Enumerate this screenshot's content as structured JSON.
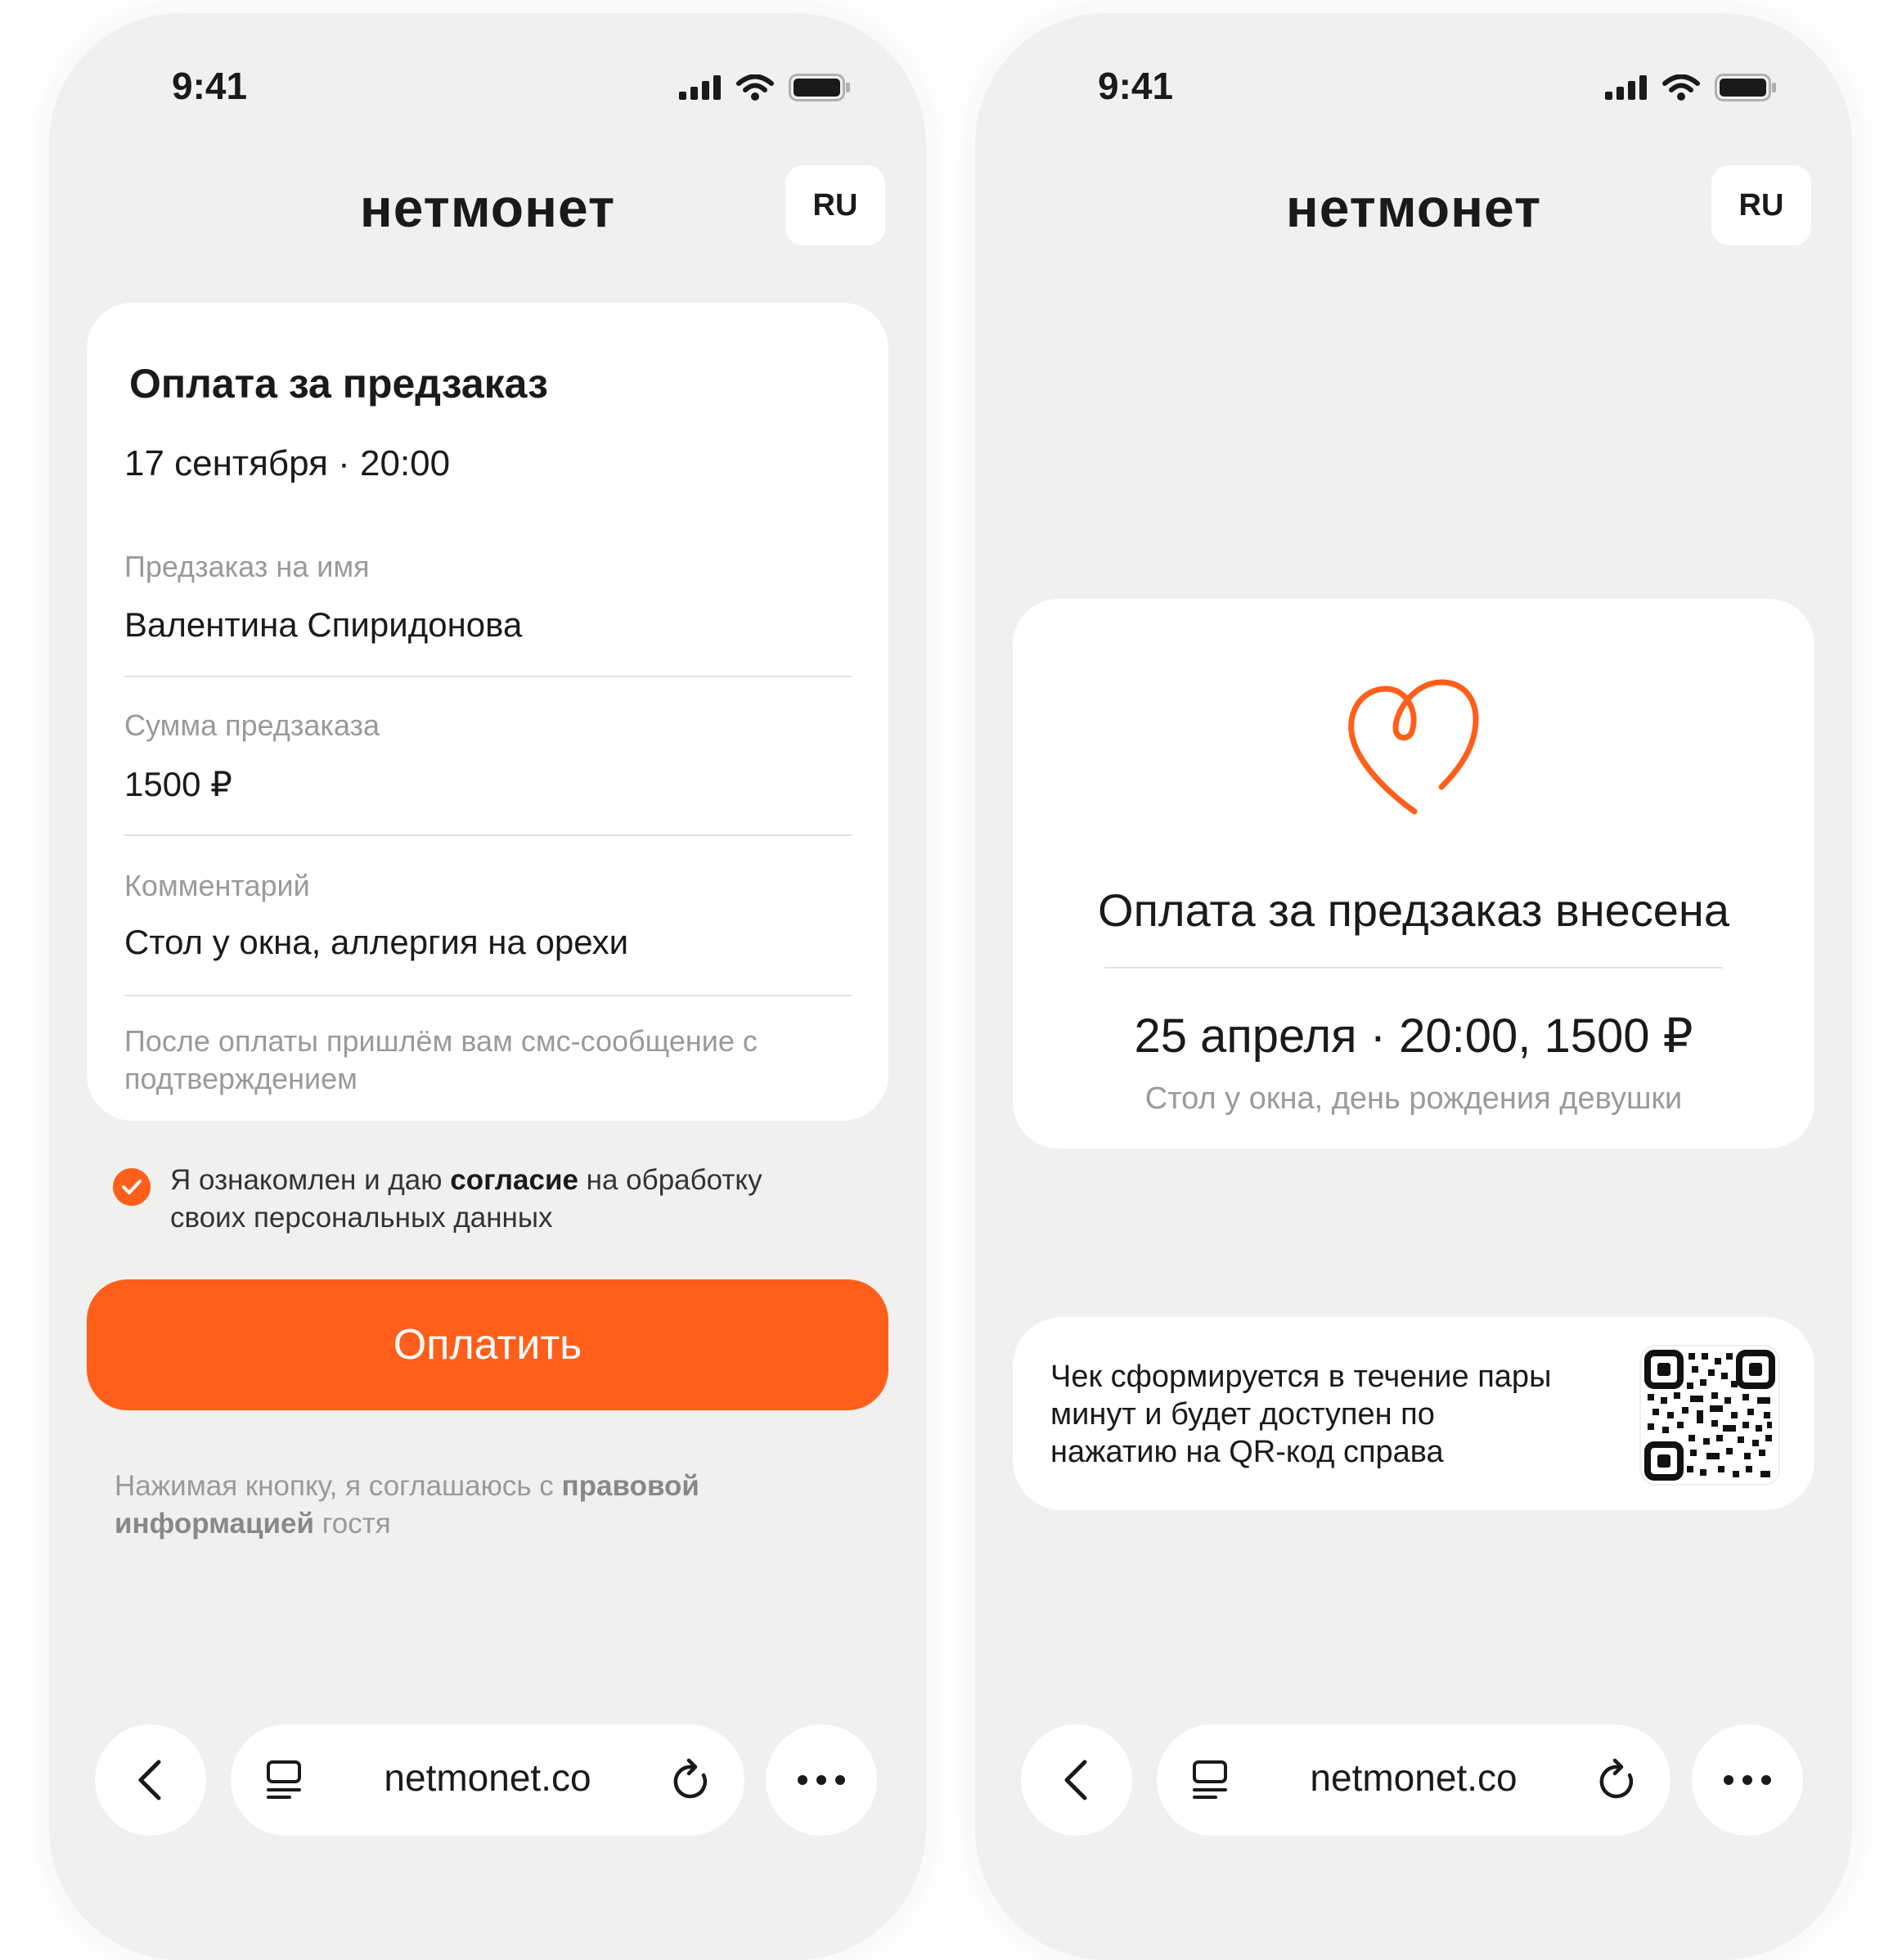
{
  "status_bar": {
    "time": "9:41"
  },
  "brand": {
    "logo": "нетмонет",
    "language": "RU",
    "accent_color": "#ff5f1a"
  },
  "payment_form": {
    "title": "Оплата за предзаказ",
    "datetime": "17 сентября · 20:00",
    "fields": [
      {
        "label": "Предзаказ на имя",
        "value": "Валентина Спиридонова"
      },
      {
        "label": "Сумма предзаказа",
        "value": "1500 ₽"
      },
      {
        "label": "Комментарий",
        "value": "Стол у окна, аллергия на орехи"
      }
    ],
    "note": "После оплаты пришлём вам смс-сообщение с подтверждением",
    "consent": {
      "checked": true,
      "prefix": "Я ознакомлен и даю ",
      "bold": "согласие",
      "suffix": " на обработку своих персональных данных"
    },
    "pay_button": "Оплатить",
    "legal": {
      "prefix": "Нажимая кнопку, я соглашаюсь с ",
      "bold": "правовой информацией",
      "suffix": " гостя"
    }
  },
  "success": {
    "icon": "heart-icon",
    "title": "Оплата за предзаказ внесена",
    "detail": "25 апреля · 20:00, 1500 ₽",
    "comment": "Стол у окна, день рождения девушки",
    "receipt_text": "Чек сформируется в течение пары минут и будет доступен по нажатию на QR-код справа",
    "qr_icon": "qr-code-icon"
  },
  "browser": {
    "url": "netmonet.co",
    "icons": [
      "back-icon",
      "reader-icon",
      "reload-icon",
      "more-icon"
    ]
  }
}
